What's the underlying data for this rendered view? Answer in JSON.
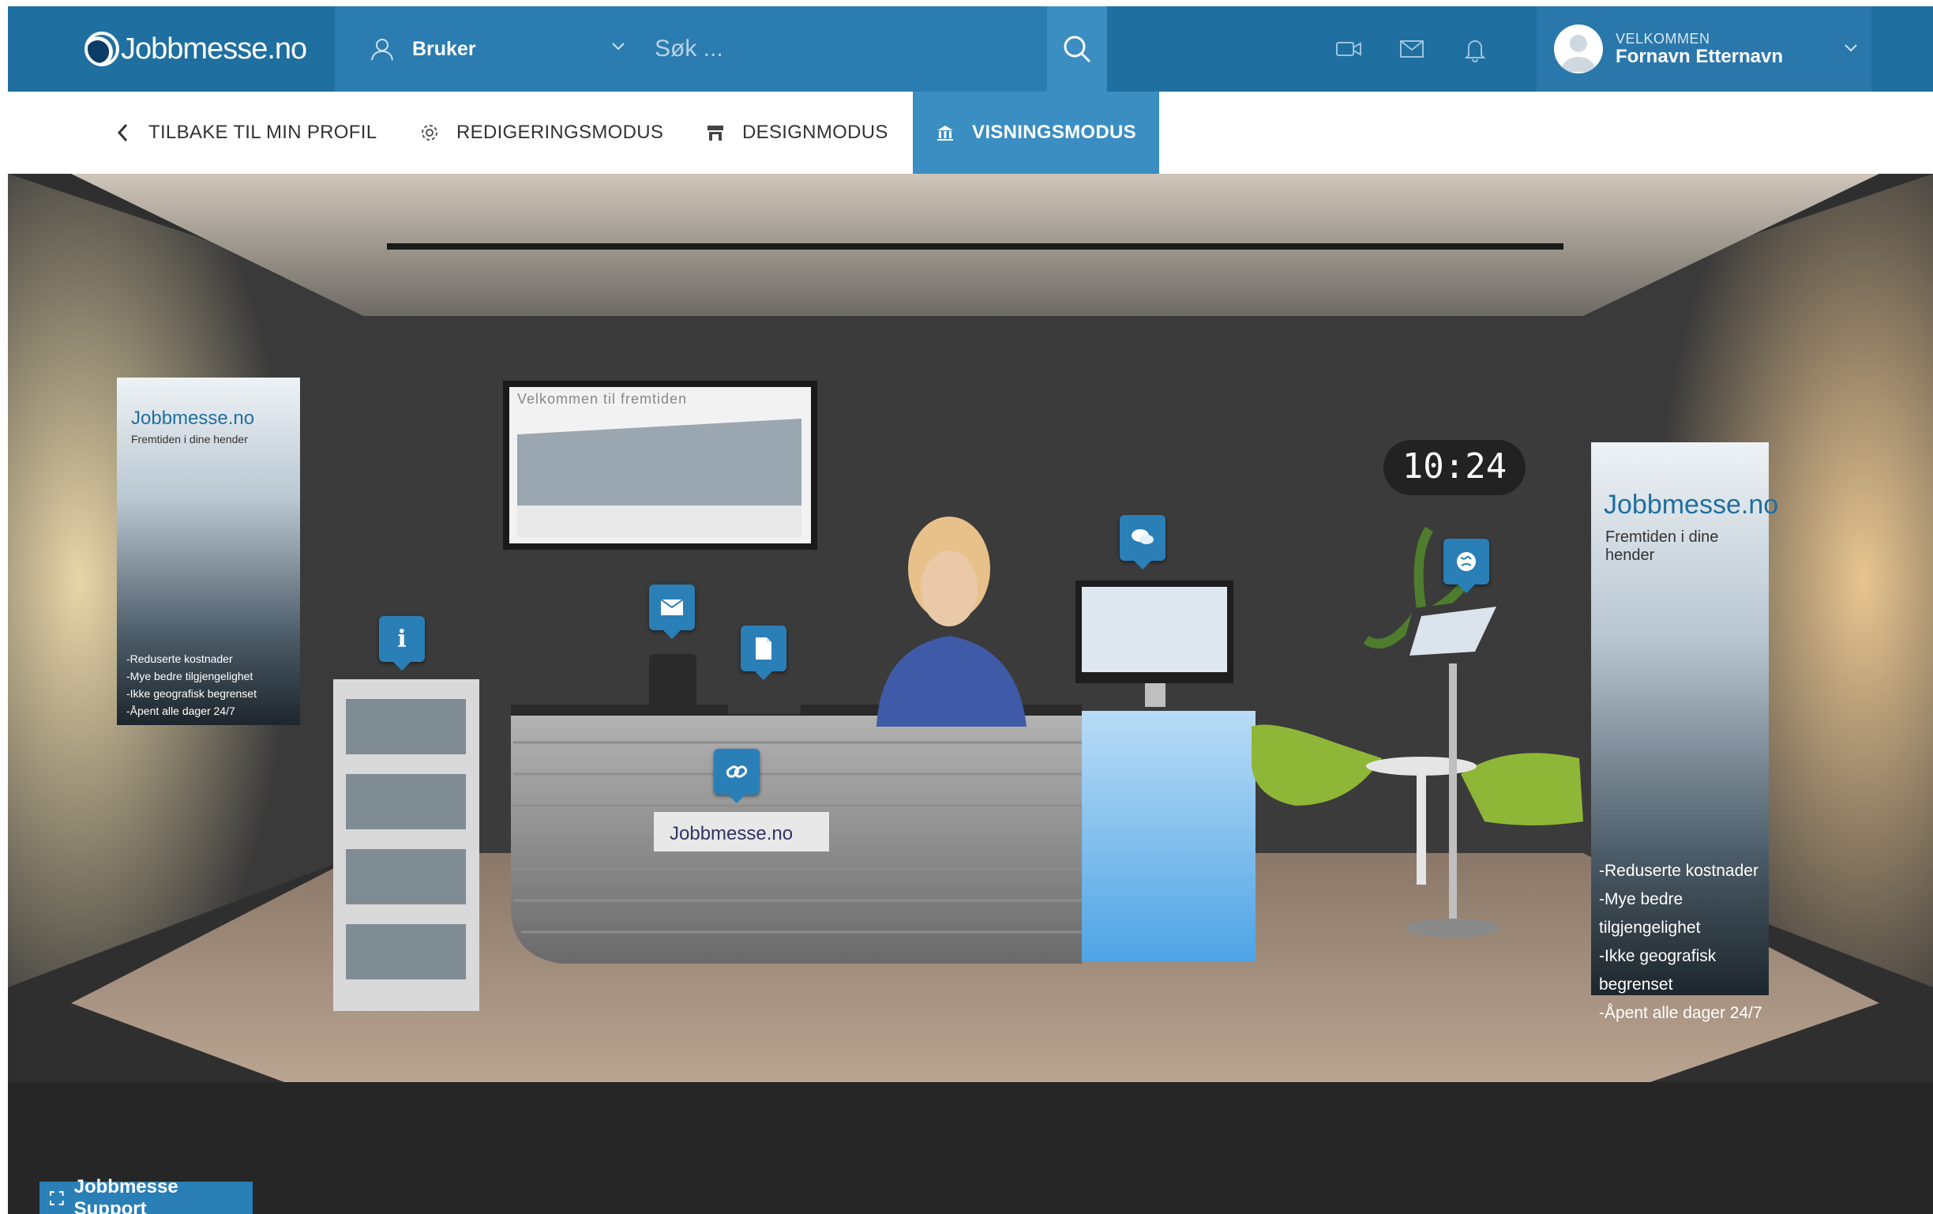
{
  "app": {
    "logo_text": "Jobbmesse.no"
  },
  "topbar": {
    "user_dropdown_label": "Bruker",
    "search_placeholder": "Søk ...",
    "welcome_small": "VELKOMMEN",
    "welcome_name": "Fornavn Etternavn"
  },
  "subnav": {
    "back": "TILBAKE TIL MIN PROFIL",
    "edit": "REDIGERINGSMODUS",
    "design": "DESIGNMODUS",
    "view": "VISNINGSMODUS"
  },
  "booth": {
    "clock": "10:24",
    "screen_title": "Velkommen til fremtiden",
    "desk_logo": "Jobbmesse.no",
    "banner_brand": "Jobbmesse.no",
    "banner_tagline": "Fremtiden i dine hender",
    "banner_bullets": [
      "-Reduserte kostnader",
      "-Mye bedre tilgjengelighet",
      "-Ikke geografisk begrenset",
      "-Åpent alle dager 24/7"
    ]
  },
  "support": {
    "label": "Jobbmesse Support"
  },
  "colors": {
    "primary": "#1f6fa0",
    "active": "#3a8ec2",
    "hotspot": "#2a7fb7"
  }
}
